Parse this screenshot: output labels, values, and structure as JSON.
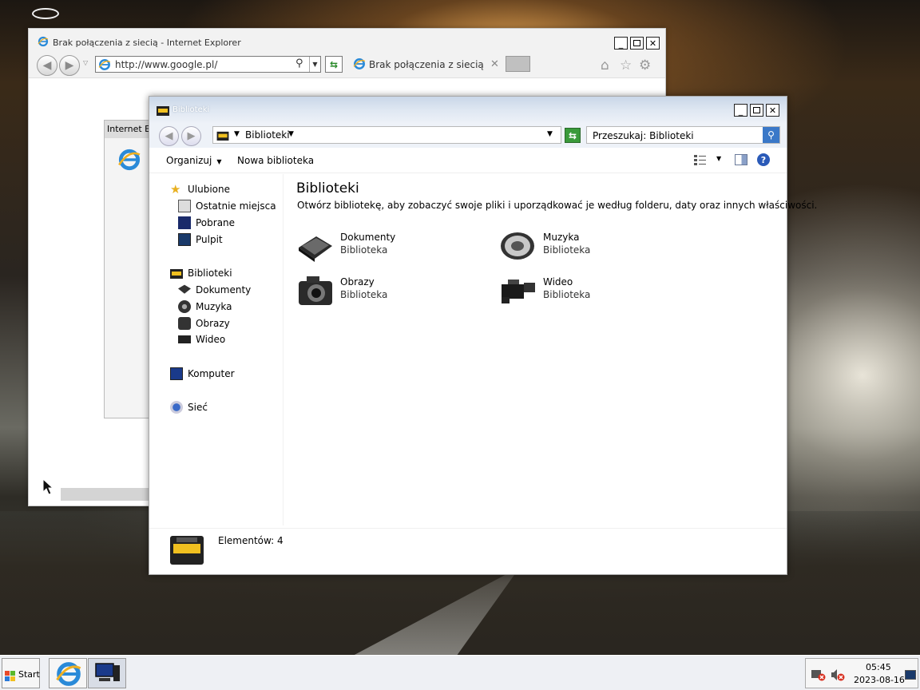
{
  "ie_window": {
    "title": "Brak połączenia z siecią - Internet Explorer",
    "address": "http://www.google.pl/",
    "tab_label": "Brak połączenia z siecią",
    "inner_dialog_title": "Internet Explorer"
  },
  "explorer": {
    "title": "Biblioteki",
    "address_crumb": "Biblioteki",
    "search_placeholder": "Przeszukaj: Biblioteki",
    "commands": {
      "organize": "Organizuj",
      "new_library": "Nowa biblioteka"
    },
    "nav": {
      "favorites": "Ulubione",
      "recent": "Ostatnie miejsca",
      "downloads": "Pobrane",
      "desktop": "Pulpit",
      "libraries": "Biblioteki",
      "documents": "Dokumenty",
      "music": "Muzyka",
      "pictures": "Obrazy",
      "videos": "Wideo",
      "computer": "Komputer",
      "network": "Sieć"
    },
    "content": {
      "title": "Biblioteki",
      "description": "Otwórz bibliotekę, aby zobaczyć swoje pliki i uporządkować je według folderu, daty oraz innych właściwości.",
      "items": [
        {
          "name": "Dokumenty",
          "type": "Biblioteka",
          "icon": "documents-library-icon"
        },
        {
          "name": "Muzyka",
          "type": "Biblioteka",
          "icon": "music-library-icon"
        },
        {
          "name": "Obrazy",
          "type": "Biblioteka",
          "icon": "pictures-library-icon"
        },
        {
          "name": "Wideo",
          "type": "Biblioteka",
          "icon": "videos-library-icon"
        }
      ]
    },
    "details": "Elementów: 4"
  },
  "taskbar": {
    "start_label": "Start",
    "time": "05:45",
    "date": "2023-08-16"
  },
  "colors": {
    "accent_blue": "#3a78c8",
    "refresh_green": "#3a9a3a",
    "library_yellow": "#f0c020"
  }
}
